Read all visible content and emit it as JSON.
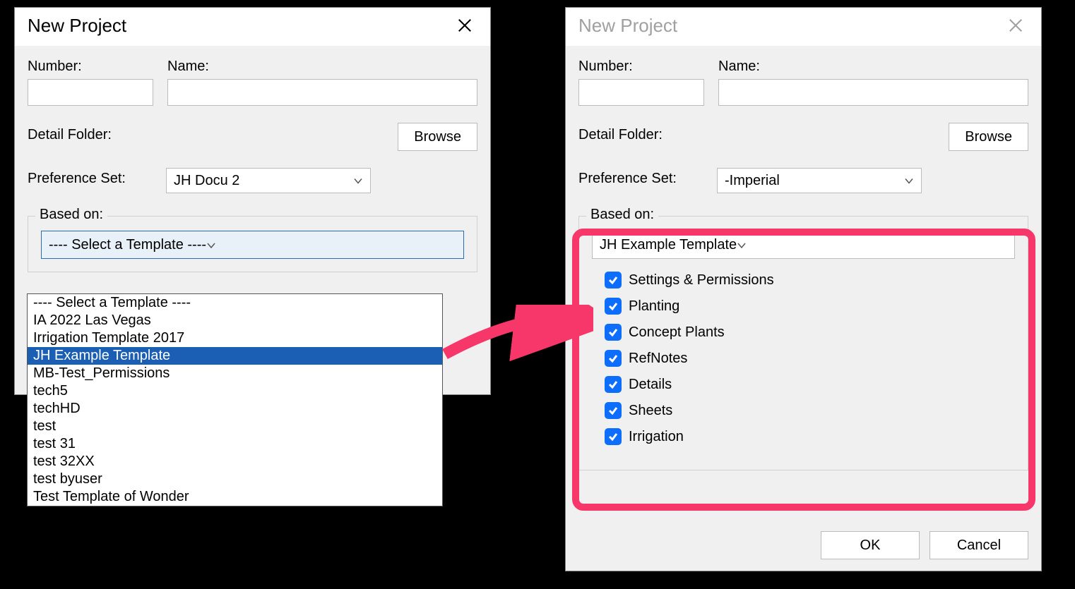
{
  "leftDialog": {
    "title": "New Project",
    "labels": {
      "number": "Number:",
      "name": "Name:",
      "detailFolder": "Detail Folder:",
      "browse": "Browse",
      "prefSet": "Preference Set:",
      "basedOn": "Based on:"
    },
    "prefSetValue": "JH Docu 2",
    "templateSelected": "---- Select a Template ----",
    "dropdownOptions": [
      "---- Select a Template ----",
      "IA 2022 Las Vegas",
      "Irrigation Template 2017",
      "JH Example Template",
      "MB-Test_Permissions",
      "tech5",
      "techHD",
      "test",
      "test 31",
      "test 32XX",
      "test byuser",
      "Test Template of Wonder"
    ],
    "highlightedIndex": 3
  },
  "rightDialog": {
    "title": "New Project",
    "labels": {
      "number": "Number:",
      "name": "Name:",
      "detailFolder": "Detail Folder:",
      "browse": "Browse",
      "prefSet": "Preference Set:",
      "basedOn": "Based on:"
    },
    "prefSetValue": "-Imperial",
    "templateSelected": "JH Example Template",
    "checks": [
      "Settings & Permissions",
      "Planting",
      "Concept Plants",
      "RefNotes",
      "Details",
      "Sheets",
      "Irrigation"
    ],
    "buttons": {
      "ok": "OK",
      "cancel": "Cancel"
    }
  },
  "annotation": {
    "highlightColor": "#f7366a"
  }
}
